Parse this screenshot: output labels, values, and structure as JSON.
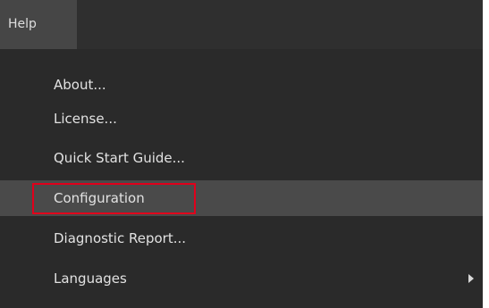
{
  "menubar": {
    "help_label": "Help"
  },
  "menu": {
    "items": [
      {
        "label": "About..."
      },
      {
        "label": "License..."
      },
      {
        "label": "Quick Start Guide..."
      },
      {
        "label": "Configuration",
        "highlighted": true
      },
      {
        "label": "Diagnostic Report..."
      },
      {
        "label": "Languages",
        "has_submenu": true,
        "submenu_icon": "chevron-right-icon"
      }
    ]
  },
  "colors": {
    "menubar_background": "#2f2f2f",
    "menu_background": "#2a2a2a",
    "highlighted_row_background": "#4a4a4a",
    "annotation_outline": "#e0001b",
    "text": "#e2e2e2"
  }
}
